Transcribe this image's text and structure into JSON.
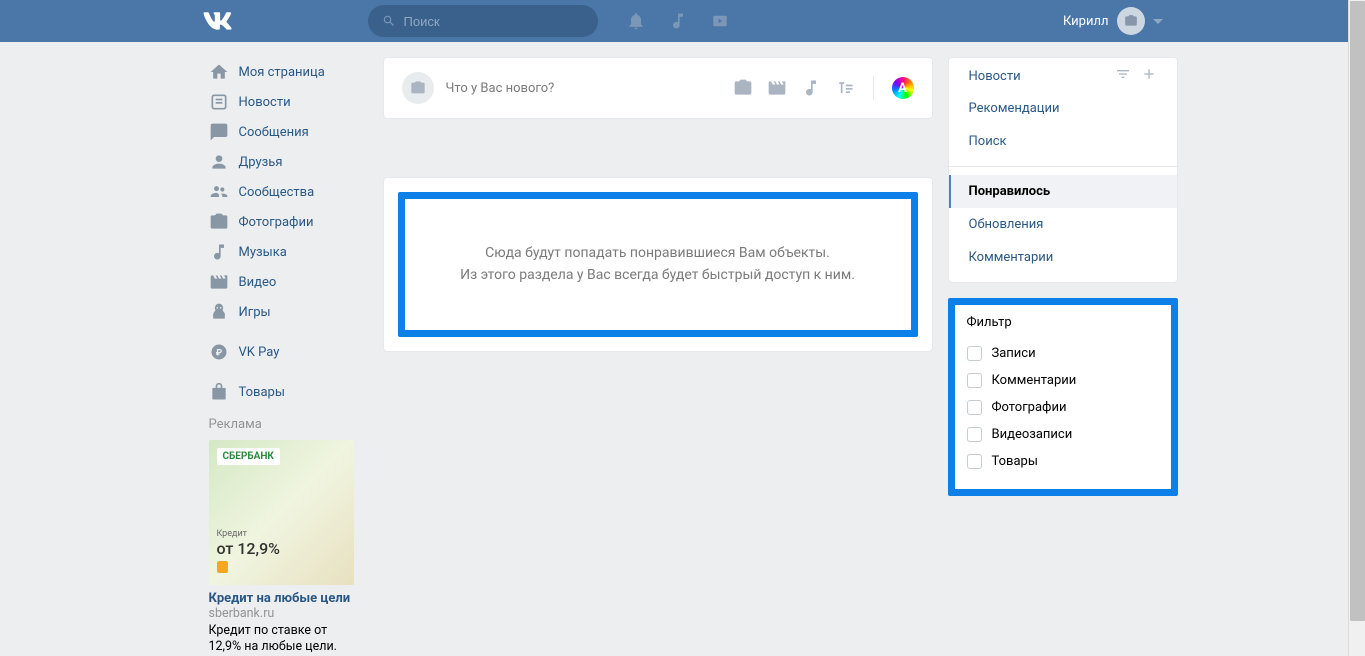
{
  "header": {
    "search_placeholder": "Поиск",
    "username": "Кирилл"
  },
  "nav": {
    "my_page": "Моя страница",
    "news": "Новости",
    "messages": "Сообщения",
    "friends": "Друзья",
    "communities": "Сообщества",
    "photos": "Фотографии",
    "music": "Музыка",
    "videos": "Видео",
    "games": "Игры",
    "vkpay": "VK Pay",
    "goods": "Товары"
  },
  "ad": {
    "section_label": "Реклама",
    "brand": "СБЕРБАНК",
    "kredit_label": "Кредит",
    "rate": "от 12,9%",
    "title": "Кредит на любые цели",
    "domain": "sberbank.ru",
    "desc": "Кредит по ставке от 12,9% на любые цели."
  },
  "post_box": {
    "placeholder": "Что у Вас нового?",
    "rainbow_letter": "A"
  },
  "empty": {
    "line1": "Сюда будут попадать понравившиеся Вам объекты.",
    "line2": "Из этого раздела у Вас всегда будет быстрый доступ к ним."
  },
  "side": {
    "news": "Новости",
    "recommendations": "Рекомендации",
    "search": "Поиск",
    "liked": "Понравилось",
    "updates": "Обновления",
    "comments": "Комментарии"
  },
  "filter": {
    "title": "Фильтр",
    "posts": "Записи",
    "comments": "Комментарии",
    "photos": "Фотографии",
    "videos": "Видеозаписи",
    "goods": "Товары"
  }
}
